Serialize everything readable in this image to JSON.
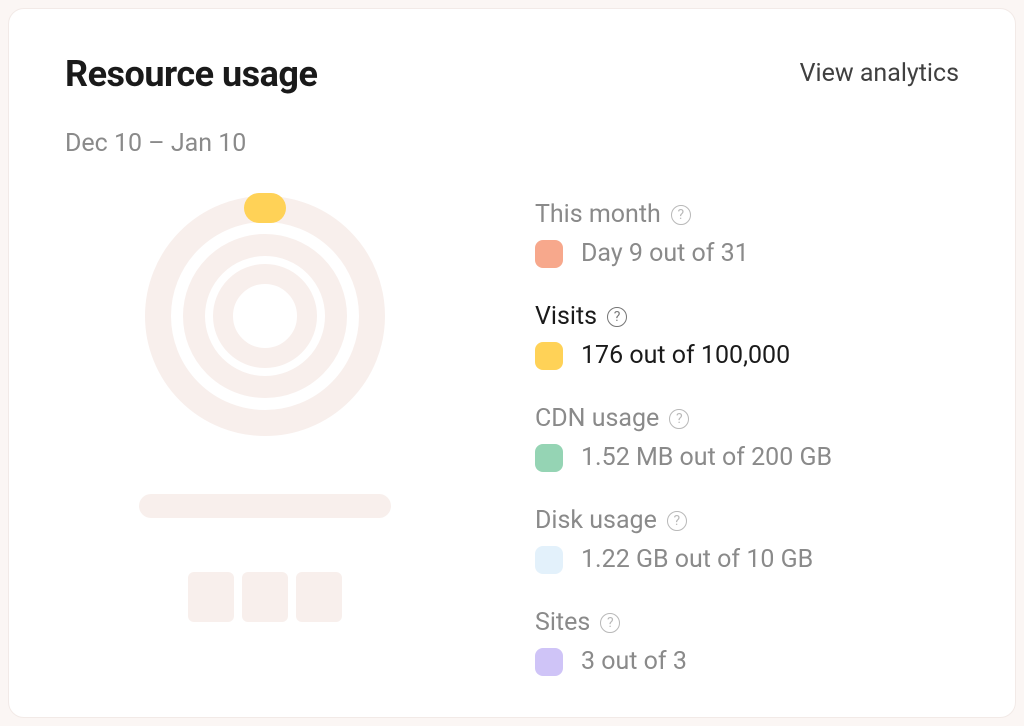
{
  "header": {
    "title": "Resource usage",
    "view_analytics": "View analytics",
    "daterange": "Dec 10 – Jan 10"
  },
  "stats": {
    "month": {
      "label": "This month",
      "value": "Day 9 out of 31",
      "color": "#f7a88c",
      "current": 9,
      "max": 31
    },
    "visits": {
      "label": "Visits",
      "value": "176 out of 100,000",
      "color": "#ffd257",
      "current": 176,
      "max": 100000
    },
    "cdn": {
      "label": "CDN usage",
      "value": "1.52 MB out of 200 GB",
      "color": "#95d4b4",
      "current_display": "1.52 MB",
      "max_display": "200 GB"
    },
    "disk": {
      "label": "Disk usage",
      "value": "1.22 GB out of 10 GB",
      "color": "#e3f1fb",
      "current_display": "1.22 GB",
      "max_display": "10 GB"
    },
    "sites": {
      "label": "Sites",
      "value": "3 out of 3",
      "color": "#cfc4f7",
      "current": 3,
      "max": 3
    }
  },
  "chart_data": {
    "type": "pie",
    "title": "Resource usage",
    "series": [
      {
        "name": "This month",
        "value": 9,
        "max": 31,
        "color": "#f7a88c"
      },
      {
        "name": "Visits",
        "value": 176,
        "max": 100000,
        "color": "#ffd257"
      },
      {
        "name": "CDN usage",
        "value": 1.52,
        "max": 200000,
        "unit": "MB",
        "color": "#95d4b4"
      },
      {
        "name": "Disk usage",
        "value": 1.22,
        "max": 10,
        "unit": "GB",
        "color": "#e3f1fb"
      },
      {
        "name": "Sites",
        "value": 3,
        "max": 3,
        "color": "#cfc4f7"
      }
    ]
  }
}
